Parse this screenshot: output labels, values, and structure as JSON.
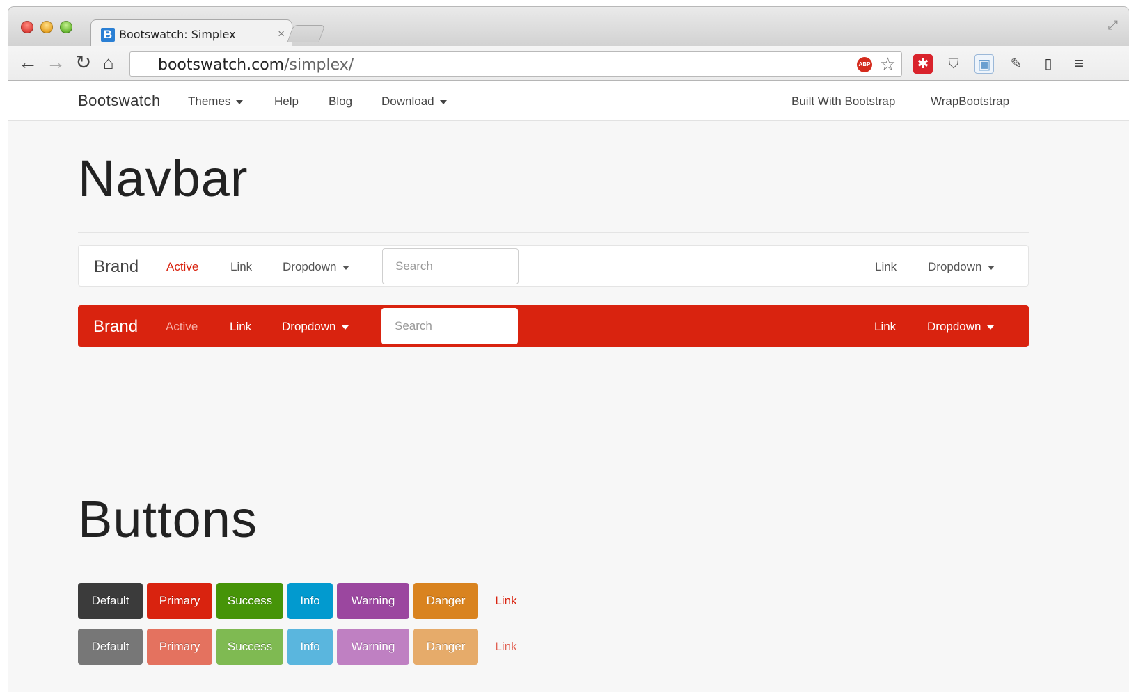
{
  "browser": {
    "tab_title": "Bootswatch: Simplex",
    "tab_favicon_letter": "B",
    "tab_close": "×",
    "url_host": "bootswatch.com",
    "url_path": "/simplex/",
    "abp_label": "ABP",
    "icons": [
      "back-arrow-icon",
      "forward-arrow-icon",
      "reload-icon",
      "home-icon",
      "bookmark-star-icon",
      "adblock-icon",
      "lastpass-icon",
      "pocket-icon",
      "extension-icon",
      "eyedropper-icon",
      "device-icon",
      "menu-icon"
    ]
  },
  "topnav": {
    "brand": "Bootswatch",
    "themes": "Themes",
    "help": "Help",
    "blog": "Blog",
    "download": "Download",
    "built_with": "Built With Bootstrap",
    "wrap": "WrapBootstrap"
  },
  "sections": {
    "navbar_title": "Navbar",
    "buttons_title": "Buttons"
  },
  "demo_navbar": {
    "brand": "Brand",
    "active": "Active",
    "link": "Link",
    "dropdown": "Dropdown",
    "search_placeholder": "Search",
    "right_link": "Link",
    "right_dropdown": "Dropdown"
  },
  "buttons": {
    "labels": [
      "Default",
      "Primary",
      "Success",
      "Info",
      "Warning",
      "Danger",
      "Link"
    ],
    "colors": [
      "#3b3b3b",
      "#d9230f",
      "#469408",
      "#029acf",
      "#9b479f",
      "#d9831f"
    ],
    "disabled_colors": [
      "#777777",
      "#e4725f",
      "#7fba52",
      "#5ab6de",
      "#bf80c2",
      "#e6ab6a"
    ]
  },
  "colors": {
    "accent": "#d9230f",
    "page_bg": "#f7f7f7"
  }
}
